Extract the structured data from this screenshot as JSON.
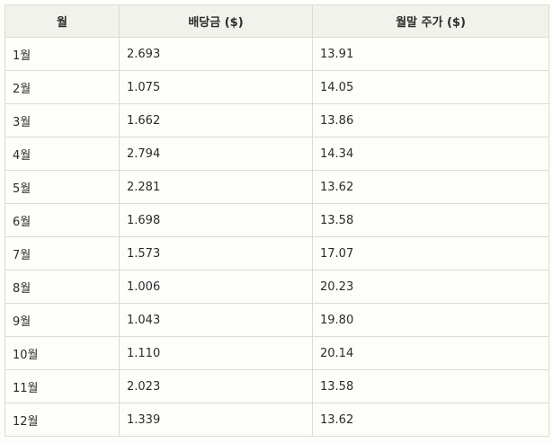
{
  "table": {
    "headers": [
      "월",
      "배당금 ($)",
      "월말 주가 ($)"
    ],
    "rows": [
      [
        "1월",
        "2.693",
        "13.91"
      ],
      [
        "2월",
        "1.075",
        "14.05"
      ],
      [
        "3월",
        "1.662",
        "13.86"
      ],
      [
        "4월",
        "2.794",
        "14.34"
      ],
      [
        "5월",
        "2.281",
        "13.62"
      ],
      [
        "6월",
        "1.698",
        "13.58"
      ],
      [
        "7월",
        "1.573",
        "17.07"
      ],
      [
        "8월",
        "1.006",
        "20.23"
      ],
      [
        "9월",
        "1.043",
        "19.80"
      ],
      [
        "10월",
        "1.110",
        "20.14"
      ],
      [
        "11월",
        "2.023",
        "13.58"
      ],
      [
        "12월",
        "1.339",
        "13.62"
      ]
    ]
  }
}
